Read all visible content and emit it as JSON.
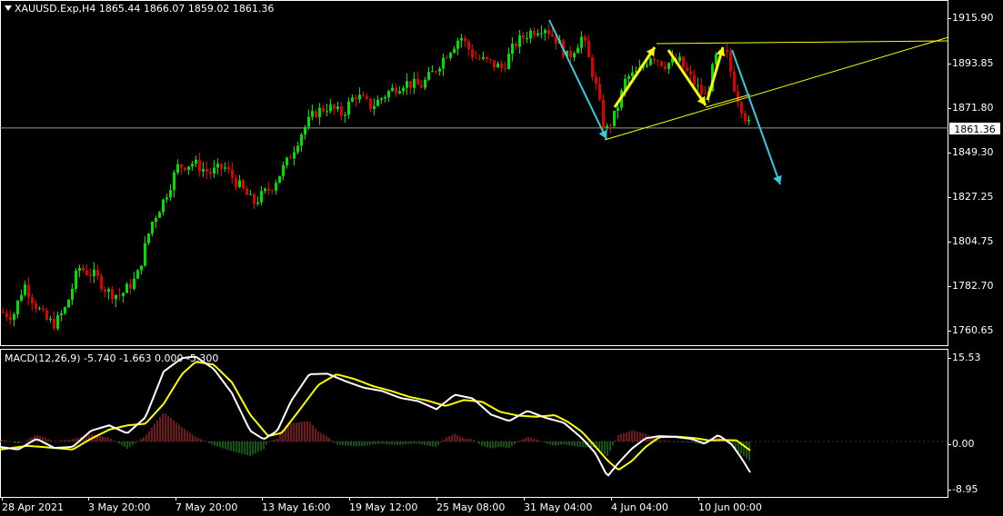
{
  "header": {
    "symbol": "XAUUSD.Exp,H4",
    "open": "1865.44",
    "high": "1866.07",
    "low": "1859.02",
    "close": "1861.36"
  },
  "price_axis": {
    "labels": [
      "1915.90",
      "1893.85",
      "1871.80",
      "1849.30",
      "1827.25",
      "1804.75",
      "1782.70",
      "1760.65"
    ],
    "current_price": "1861.36"
  },
  "macd": {
    "header": "MACD(12,26,9) -5.740 -1.663 0.000 -5.300",
    "axis_labels": [
      "15.53",
      "0.00",
      "-8.95"
    ]
  },
  "time_axis": {
    "labels": [
      "28 Apr 2021",
      "3 May 20:00",
      "7 May 20:00",
      "13 May 16:00",
      "19 May 12:00",
      "25 May 08:00",
      "31 May 04:00",
      "4 Jun 04:00",
      "10 Jun 00:00"
    ]
  },
  "colors": {
    "background": "#000000",
    "bull_candle": "#00e000",
    "bear_candle": "#e00000",
    "axis": "#ffffff",
    "pattern_lines": "#ffff00",
    "arrows_blue": "#33ccdd",
    "arrows_yellow": "#ffff00",
    "macd_line": "#ffffff",
    "signal_line": "#ffff00",
    "hist_pos": "#dd3333",
    "hist_neg": "#22aa22"
  },
  "chart_data": {
    "type": "candlestick",
    "symbol": "XAUUSD",
    "timeframe": "H4",
    "price_range": [
      1752,
      1922
    ],
    "price_path": [
      [
        0,
        1770
      ],
      [
        14,
        1768
      ],
      [
        26,
        1784
      ],
      [
        38,
        1774
      ],
      [
        50,
        1766
      ],
      [
        60,
        1764
      ],
      [
        72,
        1772
      ],
      [
        86,
        1792
      ],
      [
        104,
        1788
      ],
      [
        118,
        1780
      ],
      [
        132,
        1778
      ],
      [
        150,
        1787
      ],
      [
        166,
        1814
      ],
      [
        180,
        1826
      ],
      [
        195,
        1842
      ],
      [
        212,
        1844
      ],
      [
        230,
        1839
      ],
      [
        246,
        1842
      ],
      [
        262,
        1833
      ],
      [
        278,
        1824
      ],
      [
        298,
        1832
      ],
      [
        316,
        1845
      ],
      [
        332,
        1860
      ],
      [
        346,
        1869
      ],
      [
        360,
        1872
      ],
      [
        376,
        1868
      ],
      [
        390,
        1878
      ],
      [
        408,
        1872
      ],
      [
        426,
        1879
      ],
      [
        444,
        1884
      ],
      [
        462,
        1882
      ],
      [
        476,
        1889
      ],
      [
        490,
        1898
      ],
      [
        506,
        1907
      ],
      [
        520,
        1897
      ],
      [
        536,
        1894
      ],
      [
        552,
        1891
      ],
      [
        566,
        1903
      ],
      [
        582,
        1909
      ],
      [
        598,
        1912
      ],
      [
        612,
        1905
      ],
      [
        624,
        1896
      ],
      [
        640,
        1907
      ],
      [
        654,
        1884
      ],
      [
        665,
        1859
      ],
      [
        676,
        1868
      ],
      [
        688,
        1886
      ],
      [
        702,
        1889
      ],
      [
        716,
        1898
      ],
      [
        730,
        1893
      ],
      [
        746,
        1895
      ],
      [
        762,
        1884
      ],
      [
        776,
        1876
      ],
      [
        786,
        1896
      ],
      [
        798,
        1899
      ],
      [
        808,
        1880
      ],
      [
        818,
        1868
      ],
      [
        825,
        1861
      ]
    ],
    "macd_path": [
      [
        0,
        -1.0
      ],
      [
        20,
        -1.5
      ],
      [
        40,
        0.5
      ],
      [
        60,
        -1.2
      ],
      [
        80,
        -1.0
      ],
      [
        100,
        2.0
      ],
      [
        120,
        3.0
      ],
      [
        140,
        1.5
      ],
      [
        160,
        4.5
      ],
      [
        180,
        13.0
      ],
      [
        200,
        15.5
      ],
      [
        215,
        15.8
      ],
      [
        235,
        13.5
      ],
      [
        255,
        9.0
      ],
      [
        275,
        2.0
      ],
      [
        290,
        0.4
      ],
      [
        305,
        2.0
      ],
      [
        320,
        7.5
      ],
      [
        340,
        12.5
      ],
      [
        360,
        12.6
      ],
      [
        380,
        11.2
      ],
      [
        400,
        10.0
      ],
      [
        420,
        9.4
      ],
      [
        440,
        8.1
      ],
      [
        460,
        7.5
      ],
      [
        480,
        6.0
      ],
      [
        500,
        8.7
      ],
      [
        520,
        8.0
      ],
      [
        540,
        5.0
      ],
      [
        560,
        3.8
      ],
      [
        580,
        5.7
      ],
      [
        600,
        4.4
      ],
      [
        620,
        3.5
      ],
      [
        640,
        0.6
      ],
      [
        655,
        -2.2
      ],
      [
        668,
        -6.5
      ],
      [
        680,
        -4.0
      ],
      [
        695,
        -1.3
      ],
      [
        710,
        0.6
      ],
      [
        725,
        1.0
      ],
      [
        740,
        0.9
      ],
      [
        760,
        0.5
      ],
      [
        775,
        -0.4
      ],
      [
        790,
        1.2
      ],
      [
        805,
        -0.6
      ],
      [
        815,
        -3.0
      ],
      [
        825,
        -5.74
      ]
    ],
    "signal_path": [
      [
        0,
        -1.5
      ],
      [
        30,
        -0.8
      ],
      [
        60,
        -1.2
      ],
      [
        80,
        -1.5
      ],
      [
        100,
        0.5
      ],
      [
        120,
        2.2
      ],
      [
        140,
        3.0
      ],
      [
        160,
        3.3
      ],
      [
        180,
        7.0
      ],
      [
        200,
        12.5
      ],
      [
        215,
        14.8
      ],
      [
        235,
        14.3
      ],
      [
        255,
        11.0
      ],
      [
        275,
        5.0
      ],
      [
        295,
        1.0
      ],
      [
        310,
        1.6
      ],
      [
        330,
        6.0
      ],
      [
        350,
        10.5
      ],
      [
        370,
        12.5
      ],
      [
        390,
        11.6
      ],
      [
        410,
        10.3
      ],
      [
        430,
        9.4
      ],
      [
        450,
        8.3
      ],
      [
        470,
        7.6
      ],
      [
        490,
        6.6
      ],
      [
        510,
        7.7
      ],
      [
        530,
        7.4
      ],
      [
        550,
        5.5
      ],
      [
        570,
        4.8
      ],
      [
        590,
        4.6
      ],
      [
        610,
        4.9
      ],
      [
        625,
        3.6
      ],
      [
        640,
        1.8
      ],
      [
        655,
        -1.0
      ],
      [
        668,
        -3.5
      ],
      [
        680,
        -5.3
      ],
      [
        695,
        -3.6
      ],
      [
        710,
        -1.0
      ],
      [
        725,
        0.8
      ],
      [
        745,
        0.9
      ],
      [
        765,
        0.6
      ],
      [
        780,
        0.2
      ],
      [
        795,
        0.3
      ],
      [
        810,
        0.2
      ],
      [
        825,
        -1.663
      ]
    ],
    "macd_range": [
      -9.5,
      16.5
    ]
  }
}
